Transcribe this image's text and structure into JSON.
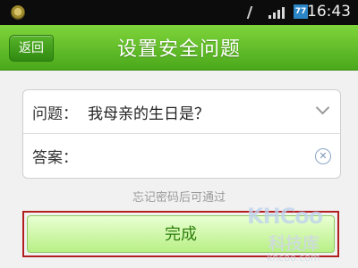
{
  "status_bar": {
    "time": "16:43",
    "battery": "77",
    "icons": [
      "app-icon",
      "bluetooth-icon",
      "signal-icon",
      "battery-icon"
    ]
  },
  "header": {
    "back_label": "返回",
    "title": "设置安全问题"
  },
  "form": {
    "question_label": "问题：",
    "question_value": "我母亲的生日是？",
    "answer_label": "答案："
  },
  "hint": "忘记密码后可通过",
  "done_label": "完成",
  "watermark": {
    "logo": "KHCoo",
    "chinese": "科技库",
    "url": "khcoo.com"
  },
  "colors": {
    "accent": "#5bb82a",
    "highlight_frame": "#b21f1f"
  }
}
